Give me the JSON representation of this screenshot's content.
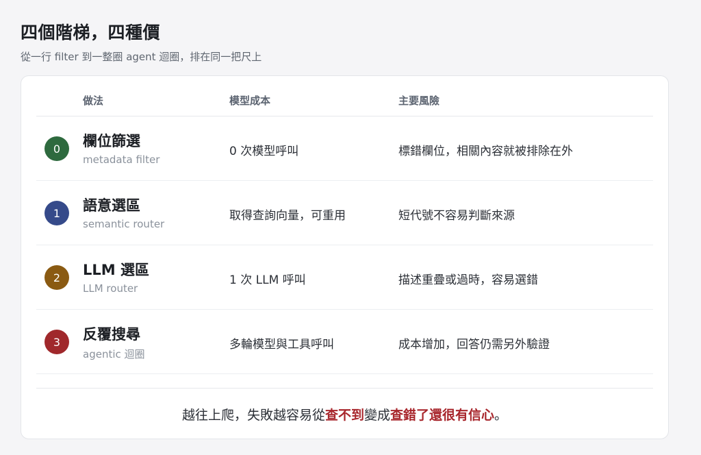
{
  "header": {
    "title": "四個階梯，四種價",
    "subtitle": "從一行 filter 到一整圈 agent 迴圈，排在同一把尺上"
  },
  "table": {
    "columns": [
      "做法",
      "模型成本",
      "主要風險"
    ],
    "rows": [
      {
        "step": "0",
        "badge_color": "#2e6a3e",
        "name": "欄位篩選",
        "sub": "metadata filter",
        "cost": "0 次模型呼叫",
        "risk": "標錯欄位，相關內容就被排除在外"
      },
      {
        "step": "1",
        "badge_color": "#354a8a",
        "name": "語意選區",
        "sub": "semantic router",
        "cost": "取得查詢向量，可重用",
        "risk": "短代號不容易判斷來源"
      },
      {
        "step": "2",
        "badge_color": "#8a5a12",
        "name": "LLM 選區",
        "sub": "LLM router",
        "cost": "1 次 LLM 呼叫",
        "risk": "描述重疊或過時，容易選錯"
      },
      {
        "step": "3",
        "badge_color": "#a0282b",
        "name": "反覆搜尋",
        "sub": "agentic 迴圈",
        "cost": "多輪模型與工具呼叫",
        "risk": "成本增加，回答仍需另外驗證"
      }
    ]
  },
  "footer": {
    "part1": "越往上爬，失敗越容易從",
    "highlight1": "查不到",
    "part2": "變成",
    "highlight2": "查錯了還很有信心",
    "part3": "。",
    "highlight_color": "#a8262c"
  }
}
